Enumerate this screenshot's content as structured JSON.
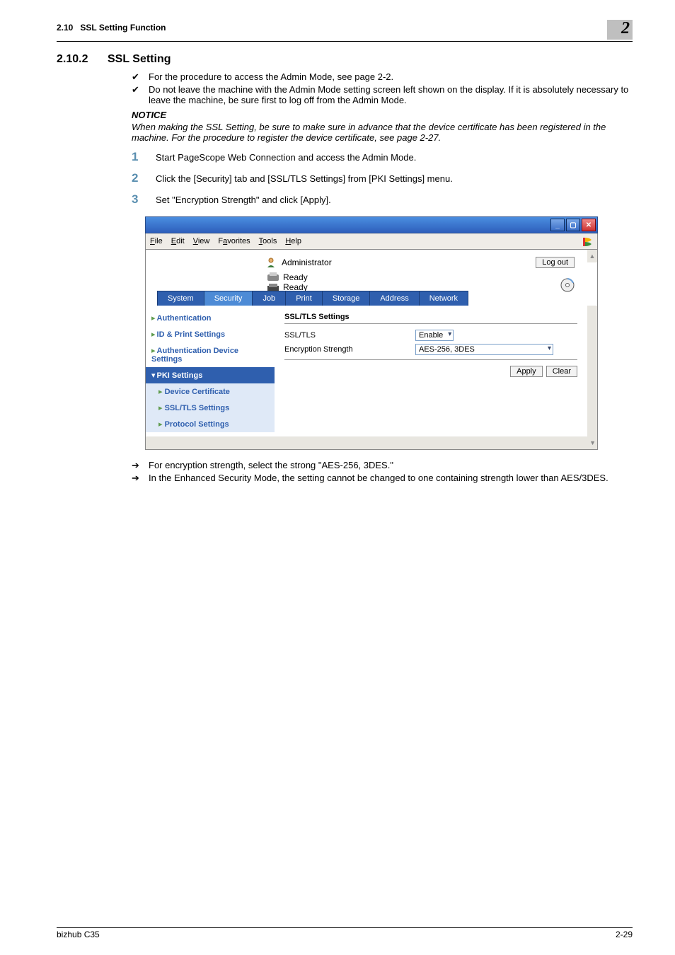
{
  "header": {
    "section_ref": "2.10",
    "section_name": "SSL Setting Function",
    "chapter": "2"
  },
  "section": {
    "num": "2.10.2",
    "title": "SSL Setting"
  },
  "checks": [
    "For the procedure to access the Admin Mode, see page 2-2.",
    "Do not leave the machine with the Admin Mode setting screen left shown on the display. If it is absolutely necessary to leave the machine, be sure first to log off from the Admin Mode."
  ],
  "notice": {
    "label": "NOTICE",
    "text": "When making the SSL Setting, be sure to make sure in advance that the device certificate has been registered in the machine. For the procedure to register the device certificate, see page 2-27."
  },
  "steps": [
    "Start PageScope Web Connection and access the Admin Mode.",
    "Click the [Security] tab and [SSL/TLS Settings] from [PKI Settings] menu.",
    "Set \"Encryption Strength\" and click [Apply]."
  ],
  "window": {
    "menus": [
      "File",
      "Edit",
      "View",
      "Favorites",
      "Tools",
      "Help"
    ],
    "admin_label": "Administrator",
    "logout": "Log out",
    "status1": "Ready",
    "status2": "Ready",
    "tabs": [
      "System",
      "Security",
      "Job",
      "Print",
      "Storage",
      "Address",
      "Network"
    ],
    "nav": {
      "auth": "Authentication",
      "idprint": "ID & Print Settings",
      "authdev": "Authentication Device Settings",
      "pki": "PKI Settings",
      "devcert": "Device Certificate",
      "ssltls": "SSL/TLS Settings",
      "protocol": "Protocol Settings"
    },
    "panel": {
      "title": "SSL/TLS Settings",
      "row1_label": "SSL/TLS",
      "row1_value": "Enable",
      "row2_label": "Encryption Strength",
      "row2_value": "AES-256, 3DES",
      "apply": "Apply",
      "clear": "Clear"
    }
  },
  "arrows": [
    "For encryption strength, select the strong \"AES-256, 3DES.\"",
    "In the Enhanced Security Mode, the setting cannot be changed to one containing strength lower than AES/3DES."
  ],
  "footer": {
    "left": "bizhub C35",
    "right": "2-29"
  }
}
